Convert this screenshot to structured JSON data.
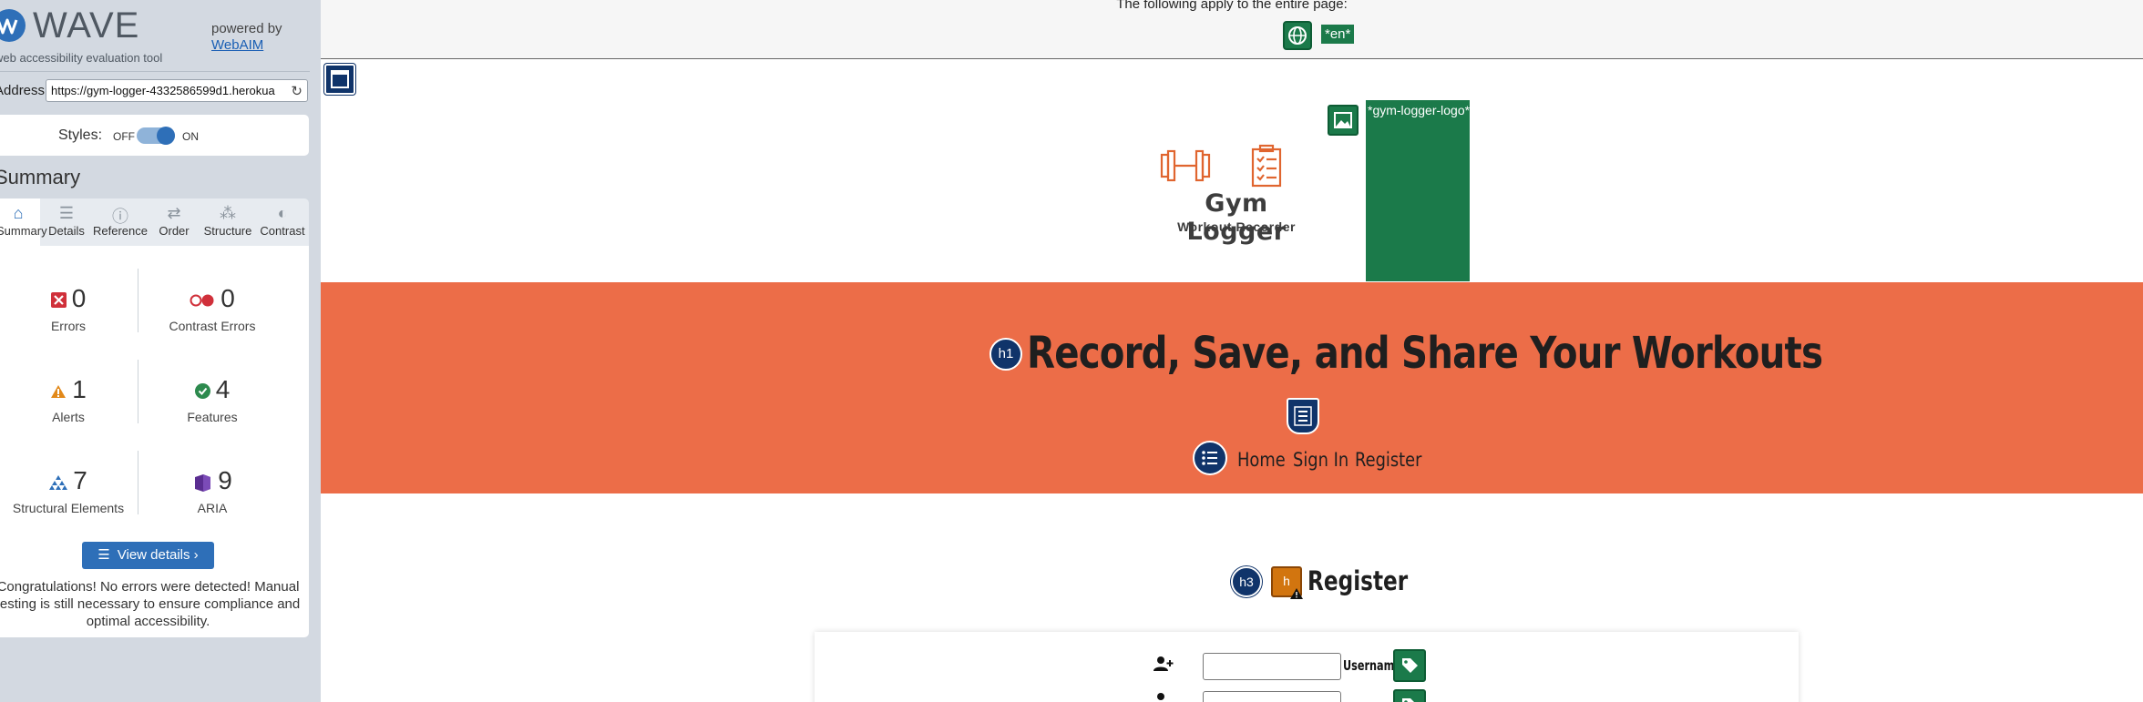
{
  "wave": {
    "brand": "WAVE",
    "tagline": "web accessibility evaluation tool",
    "powered_by": "powered by",
    "webaim_link": "WebAIM",
    "address_label": "Address:",
    "address_value": "https://gym-logger-4332586599d1.herokua",
    "styles_label": "Styles:",
    "styles_off": "OFF",
    "styles_on": "ON",
    "summary_title": "Summary",
    "tabs": [
      {
        "label": "Summary",
        "icon": "home-icon",
        "active": true
      },
      {
        "label": "Details",
        "icon": "list-icon",
        "active": false
      },
      {
        "label": "Reference",
        "icon": "info-icon",
        "active": false
      },
      {
        "label": "Order",
        "icon": "order-icon",
        "active": false
      },
      {
        "label": "Structure",
        "icon": "structure-icon",
        "active": false
      },
      {
        "label": "Contrast",
        "icon": "contrast-icon",
        "active": false
      }
    ],
    "stats": [
      {
        "count": "0",
        "label": "Errors",
        "icon": "error-icon",
        "color": "#d0303a"
      },
      {
        "count": "0",
        "label": "Contrast Errors",
        "icon": "contrast-error-icon",
        "color": "#d0303a"
      },
      {
        "count": "1",
        "label": "Alerts",
        "icon": "alert-icon",
        "color": "#e2891a"
      },
      {
        "count": "4",
        "label": "Features",
        "icon": "feature-icon",
        "color": "#2d8a4e"
      },
      {
        "count": "7",
        "label": "Structural Elements",
        "icon": "structure-icon",
        "color": "#2e6fb8"
      },
      {
        "count": "9",
        "label": "ARIA",
        "icon": "aria-icon",
        "color": "#5a2d91"
      }
    ],
    "view_details": "View details ›",
    "congrats": "Congratulations! No errors were detected! Manual testing is still necessary to ensure compliance and optimal accessibility."
  },
  "page": {
    "applies_text": "The following apply to the entire page:",
    "lang_tag": "*en*",
    "logo_title": "Gym Logger",
    "logo_subtitle": "Workout Recorder",
    "logo_alt": "*gym-logger-logo*",
    "h1_badge": "h1",
    "hero_title": "Record, Save, and Share Your Workouts",
    "nav": [
      "Home",
      "Sign In",
      "Register"
    ],
    "h3_badge": "h3",
    "alert_badge": "h",
    "register_title": "Register",
    "username_label": "Username"
  },
  "colors": {
    "hero_orange": "#ec6d48",
    "wave_blue": "#2e6fb8",
    "feature_green": "#1b7a4a",
    "structure_navy": "#10346a",
    "alert_orange": "#d2750f",
    "logo_orange": "#e0652f"
  }
}
